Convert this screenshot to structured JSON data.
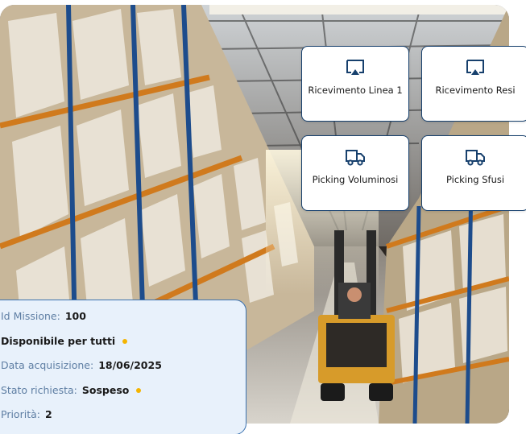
{
  "cards": [
    {
      "label": "Ricevimento Linea 1",
      "icon": "inbox-arrow-icon"
    },
    {
      "label": "Ricevimento Resi",
      "icon": "inbox-arrow-icon"
    },
    {
      "label": "Picking Voluminosi",
      "icon": "truck-icon"
    },
    {
      "label": "Picking Sfusi",
      "icon": "truck-icon"
    }
  ],
  "mission": {
    "id_label": "Id Missione:",
    "id_value": "100",
    "availability": "Disponibile per tutti",
    "acquisition_label": "Data acquisizione:",
    "acquisition_value": "18/06/2025",
    "status_label": "Stato richiesta:",
    "status_value": "Sospeso",
    "priority_label": "Priorità:",
    "priority_value": "2"
  },
  "colors": {
    "card_border": "#17406d",
    "icon": "#17406d",
    "panel_bg": "#e8f1fb",
    "panel_border": "#3b72b0",
    "label_muted": "#5e7ea3",
    "status_dot": "#f4b400"
  }
}
